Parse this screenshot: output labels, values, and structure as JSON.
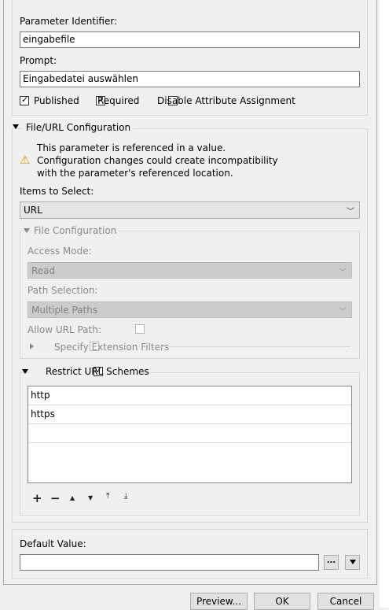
{
  "parameter": {
    "identifier_label": "Parameter Identifier:",
    "identifier_value": "eingabefile",
    "prompt_label": "Prompt:",
    "prompt_value": "Eingabedatei auswählen",
    "published_label": "Published",
    "published_checked": true,
    "required_label": "Required",
    "required_checked": true,
    "disable_attr_label": "Disable Attribute Assignment",
    "disable_attr_checked": false
  },
  "file_url_config": {
    "title": "File/URL Configuration",
    "warning_line1": "This parameter is referenced in a value.",
    "warning_line2": "Configuration changes could create incompatibility",
    "warning_line3": "with the parameter's referenced location.",
    "items_to_select_label": "Items to Select:",
    "items_to_select_value": "URL",
    "file_configuration": {
      "title": "File Configuration",
      "access_mode_label": "Access Mode:",
      "access_mode_value": "Read",
      "path_selection_label": "Path Selection:",
      "path_selection_value": "Multiple Paths",
      "allow_url_path_label": "Allow URL Path:",
      "specify_extension_label": "Specify Extension Filters"
    },
    "restrict_url_schemes": {
      "title": "Restrict URL Schemes",
      "checked": true,
      "schemes": [
        "http",
        "https",
        ""
      ]
    }
  },
  "default_value": {
    "label": "Default Value:",
    "value": "",
    "browse_label": "...",
    "menu_icon": "triangle-down-icon"
  },
  "buttons": {
    "preview": "Preview...",
    "ok": "OK",
    "cancel": "Cancel"
  },
  "icons": {
    "warning": "warning-icon",
    "add": "+",
    "remove": "−",
    "move_up": "▲",
    "move_down": "▼",
    "move_top": "⤒",
    "move_bottom": "⤓"
  }
}
